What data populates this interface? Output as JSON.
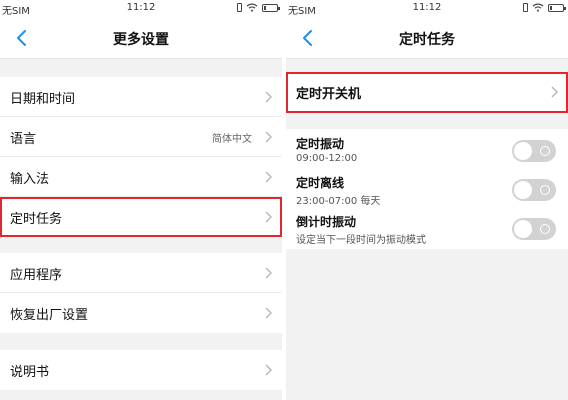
{
  "left": {
    "status": {
      "carrier": "无SIM",
      "time": "11:12"
    },
    "nav": {
      "title": "更多设置"
    },
    "groups": [
      [
        {
          "label": "日期和时间",
          "value": ""
        },
        {
          "label": "语言",
          "value": "简体中文"
        },
        {
          "label": "输入法",
          "value": ""
        },
        {
          "label": "定时任务",
          "value": "",
          "highlighted": true
        }
      ],
      [
        {
          "label": "应用程序",
          "value": ""
        },
        {
          "label": "恢复出厂设置",
          "value": ""
        }
      ],
      [
        {
          "label": "说明书",
          "value": ""
        }
      ]
    ]
  },
  "right": {
    "status": {
      "carrier": "无SIM",
      "time": "11:12"
    },
    "nav": {
      "title": "定时任务"
    },
    "power_item": {
      "label": "定时开关机",
      "highlighted": true
    },
    "toggles": [
      {
        "label": "定时振动",
        "sub": "09:00-12:00",
        "on": false
      },
      {
        "label": "定时离线",
        "sub": "23:00-07:00 每天",
        "on": false
      },
      {
        "label": "倒计时振动",
        "sub": "设定当下一段时间为振动模式",
        "on": false
      }
    ]
  },
  "colors": {
    "accent": "#1e90e6",
    "highlight": "#e0262e",
    "toggle_off": "#d2d2d2",
    "background": "#f2f2f2"
  }
}
